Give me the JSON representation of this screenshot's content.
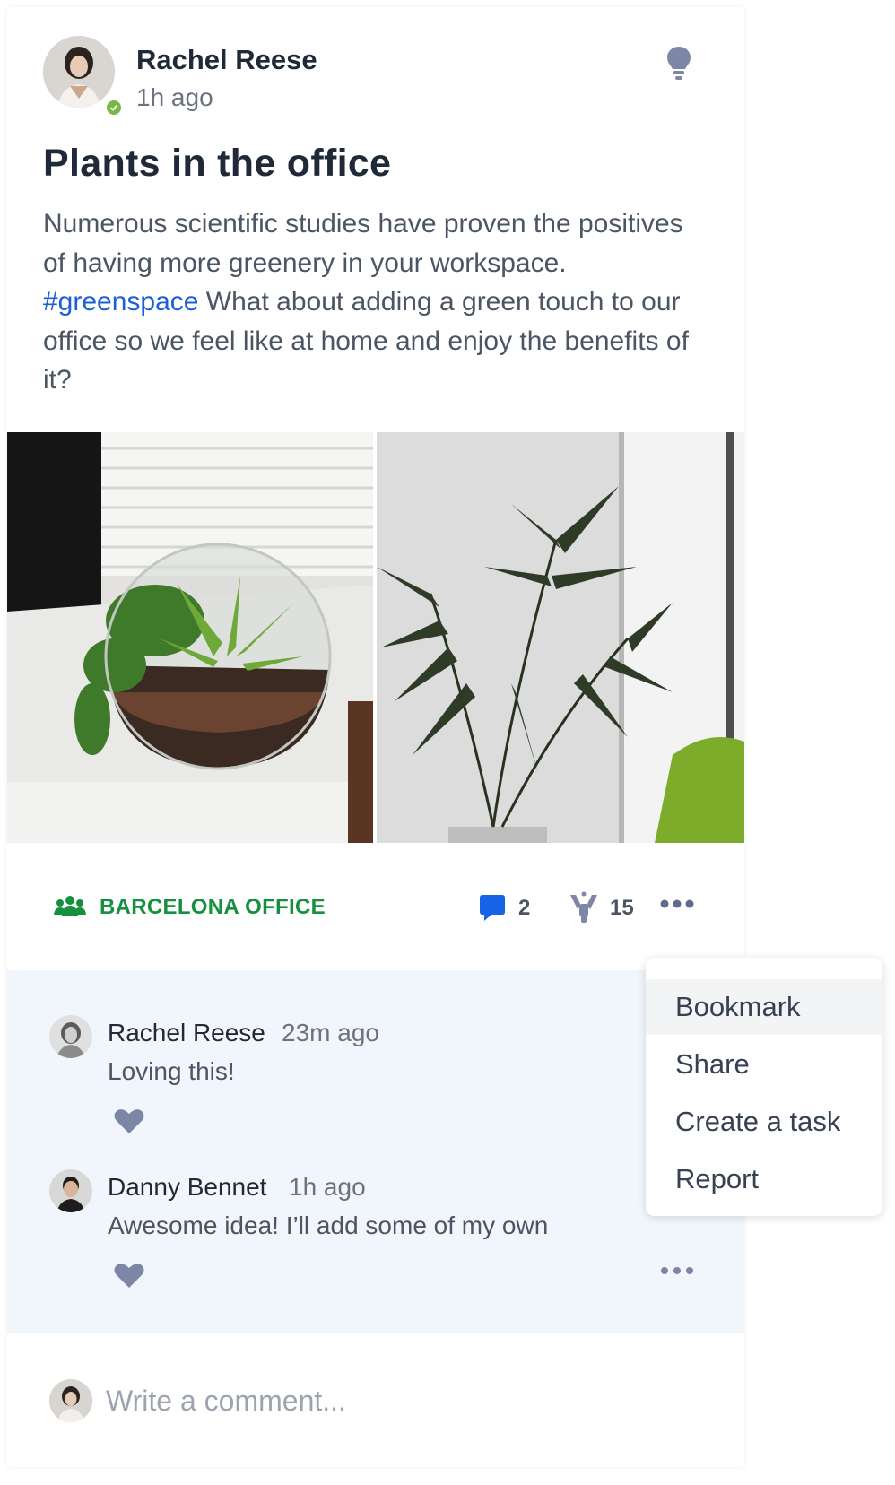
{
  "post": {
    "author": "Rachel Reese",
    "time": "1h ago",
    "title": "Plants in the office",
    "body_before": "Numerous scientific studies have proven the positives of having more greenery in your workspace. ",
    "hashtag": "#greenspace",
    "body_after": " What about adding a green touch to our office so we feel like at home and enjoy the benefits of it?",
    "group": "BARCELONA OFFICE",
    "comment_count": "2",
    "cheer_count": "15"
  },
  "comments": [
    {
      "author": "Rachel Reese",
      "time": "23m ago",
      "text": "Loving this!"
    },
    {
      "author": "Danny Bennet",
      "time": "1h ago",
      "text": "Awesome idea! I’ll add some of my own"
    }
  ],
  "composer": {
    "placeholder": "Write a comment..."
  },
  "menu": {
    "items": [
      "Bookmark",
      "Share",
      "Create a task",
      "Report"
    ],
    "highlighted": "Bookmark"
  },
  "colors": {
    "accent_green": "#14903e",
    "hashtag_blue": "#1d5fd6",
    "comment_blue": "#1763e6",
    "comments_bg": "#f1f6fd",
    "icon_gray": "#7e86a5"
  },
  "icons": [
    "online-status-icon",
    "lightbulb-icon",
    "group-icon",
    "comment-icon",
    "cheer-icon",
    "more-icon",
    "heart-icon"
  ]
}
